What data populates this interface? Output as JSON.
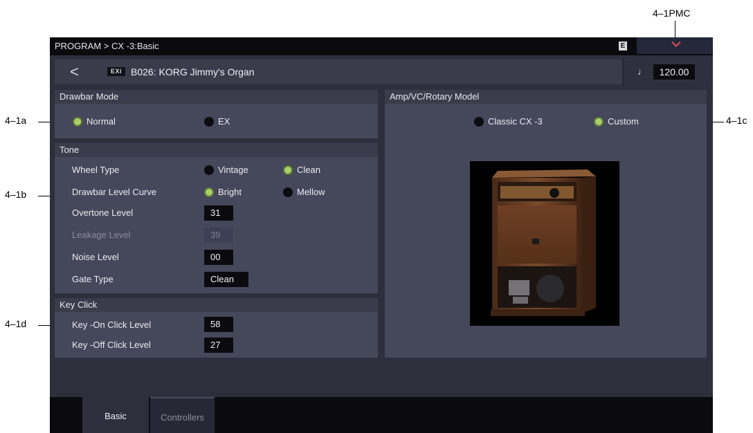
{
  "callouts": {
    "pmc": "4–1PMC",
    "a": "4–1a",
    "b": "4–1b",
    "c": "4–1c",
    "d": "4–1d"
  },
  "header": {
    "breadcrumb": "PROGRAM > CX -3:Basic",
    "edit_badge": "E"
  },
  "program": {
    "back_glyph": "<",
    "bank_badge": "EXi",
    "name": "B026: KORG Jimmy's Organ",
    "tempo_icon": "♩",
    "tempo": "120.00"
  },
  "drawbar_mode": {
    "title": "Drawbar Mode",
    "options": [
      "Normal",
      "EX"
    ],
    "selected": "Normal"
  },
  "tone": {
    "title": "Tone",
    "wheel_type": {
      "label": "Wheel Type",
      "options": [
        "Vintage",
        "Clean"
      ],
      "selected": "Clean"
    },
    "drawbar_curve": {
      "label": "Drawbar Level Curve",
      "options": [
        "Bright",
        "Mellow"
      ],
      "selected": "Bright"
    },
    "overtone": {
      "label": "Overtone Level",
      "value": "31"
    },
    "leakage": {
      "label": "Leakage Level",
      "value": "39",
      "disabled": true
    },
    "noise": {
      "label": "Noise Level",
      "value": "00"
    },
    "gate": {
      "label": "Gate Type",
      "value": "Clean"
    }
  },
  "key_click": {
    "title": "Key Click",
    "on": {
      "label": "Key -On  Click Level",
      "value": "58"
    },
    "off": {
      "label": "Key -Off Click Level",
      "value": "27"
    }
  },
  "amp": {
    "title": "Amp/VC/Rotary Model",
    "options": [
      "Classic CX -3",
      "Custom"
    ],
    "selected": "Custom",
    "image": "rotary-speaker-cabinet"
  },
  "tabs": [
    "Basic",
    "Controllers"
  ],
  "active_tab": "Basic",
  "colors": {
    "led_on": "#a8cf6a",
    "background": "#2d2f3d",
    "panel": "#45475a"
  }
}
